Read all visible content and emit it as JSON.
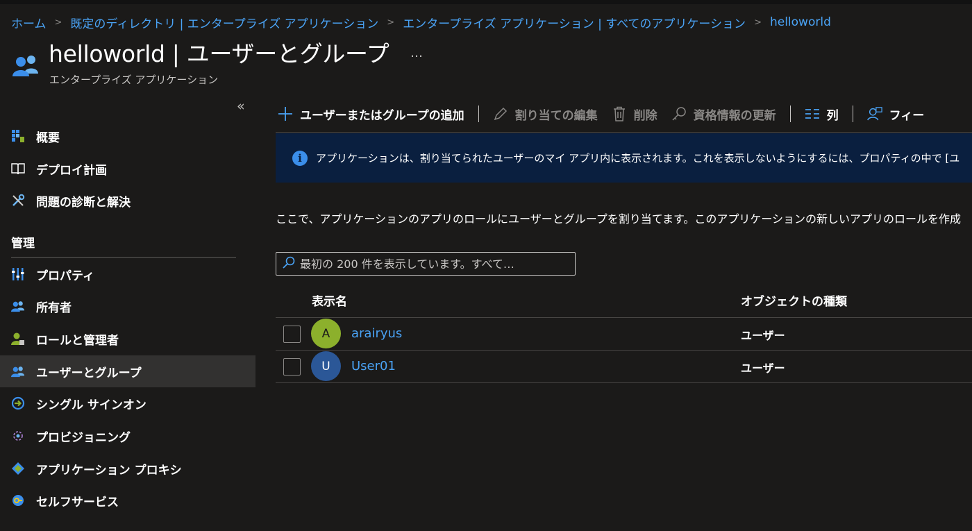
{
  "breadcrumb": [
    "ホーム",
    "既定のディレクトリ | エンタープライズ アプリケーション",
    "エンタープライズ アプリケーション | すべてのアプリケーション",
    "helloworld"
  ],
  "breadcrumb_separator": ">",
  "header": {
    "title": "helloworld | ユーザーとグループ",
    "more": "…",
    "subtitle": "エンタープライズ アプリケーション"
  },
  "sidebar": {
    "collapse": "«",
    "items_top": [
      {
        "label": "概要",
        "icon": "grid-overview-icon"
      },
      {
        "label": "デプロイ計画",
        "icon": "book-icon"
      },
      {
        "label": "問題の診断と解決",
        "icon": "wrench-icon"
      }
    ],
    "section_label": "管理",
    "items_manage": [
      {
        "label": "プロパティ",
        "icon": "properties-sliders-icon"
      },
      {
        "label": "所有者",
        "icon": "owners-icon"
      },
      {
        "label": "ロールと管理者",
        "icon": "roles-admins-icon"
      },
      {
        "label": "ユーザーとグループ",
        "icon": "users-groups-icon",
        "active": true
      },
      {
        "label": "シングル サインオン",
        "icon": "sso-icon"
      },
      {
        "label": "プロビジョニング",
        "icon": "provisioning-icon"
      },
      {
        "label": "アプリケーション プロキシ",
        "icon": "app-proxy-icon"
      },
      {
        "label": "セルフサービス",
        "icon": "self-service-icon"
      }
    ]
  },
  "toolbar": {
    "add": "ユーザーまたはグループの追加",
    "edit": "割り当ての編集",
    "delete": "削除",
    "update_credentials": "資格情報の更新",
    "columns": "列",
    "feedback": "フィー"
  },
  "banner": {
    "text": "アプリケーションは、割り当てられたユーザーのマイ アプリ内に表示されます。これを表示しないようにするには、プロパティの中で [ユ"
  },
  "description": "ここで、アプリケーションのアプリのロールにユーザーとグループを割り当てます。このアプリケーションの新しいアプリのロールを作成",
  "search": {
    "placeholder": "最初の 200 件を表示しています。すべて…"
  },
  "table": {
    "columns": [
      "表示名",
      "オブジェクトの種類"
    ],
    "rows": [
      {
        "initial": "A",
        "name": "arairyus",
        "type": "ユーザー",
        "avatar_color": "#8cb02c"
      },
      {
        "initial": "U",
        "name": "User01",
        "type": "ユーザー",
        "avatar_color": "#2b5797"
      }
    ]
  },
  "colors": {
    "link": "#4aa3f5",
    "banner_bg": "#0a1f3f",
    "active_nav": "#323130"
  }
}
